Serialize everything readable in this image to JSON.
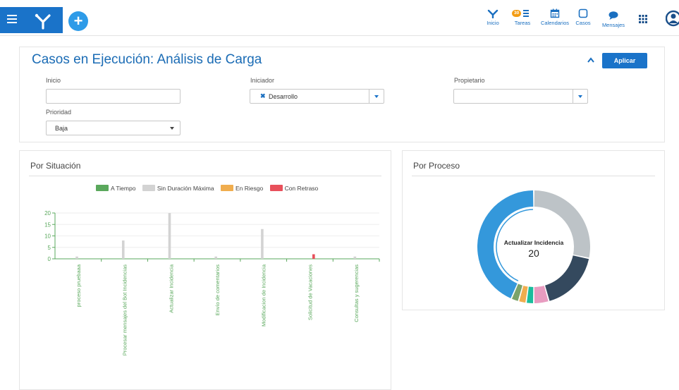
{
  "topbar": {
    "nav": [
      {
        "label": "Inicio",
        "icon": "home-branch-icon"
      },
      {
        "label": "Tareas",
        "icon": "tasks-icon",
        "badge": "30"
      },
      {
        "label": "Calendarios",
        "icon": "calendar-icon"
      },
      {
        "label": "Casos",
        "icon": "cases-icon"
      },
      {
        "label": "Mensajes",
        "icon": "messages-icon"
      }
    ],
    "add_label": "+"
  },
  "filter": {
    "title": "Casos en Ejecución: Análisis de Carga",
    "apply_label": "Aplicar",
    "inicio": {
      "label": "Inicio",
      "value": ""
    },
    "iniciador": {
      "label": "Iniciador",
      "tag": "Desarrollo",
      "remove": "✖"
    },
    "propietario": {
      "label": "Propietario",
      "value": ""
    },
    "prioridad": {
      "label": "Prioridad",
      "value": "Baja"
    }
  },
  "situacion": {
    "title": "Por Situación",
    "legend": [
      {
        "label": "A Tiempo",
        "color": "#5aa85c"
      },
      {
        "label": "Sin Duración Máxima",
        "color": "#d3d3d3"
      },
      {
        "label": "En Riesgo",
        "color": "#f0ad4e"
      },
      {
        "label": "Con Retraso",
        "color": "#e8505b"
      }
    ]
  },
  "proceso": {
    "title": "Por Proceso",
    "center_label": "Actualizar Incidencia",
    "center_value": "20"
  },
  "chart_data": [
    {
      "type": "bar",
      "title": "Por Situación",
      "categories": [
        "proceso pruebaaa",
        "Procesar mensajes del Bot Incidencias",
        "Actualizar Incidencia",
        "Envío de comentarios",
        "Modificacion de Incidencia",
        "Solicitud de Vacaciones",
        "Consultas y sugerencias"
      ],
      "series": [
        {
          "name": "A Tiempo",
          "color": "#5aa85c",
          "values": [
            0,
            0,
            0,
            0,
            0,
            0,
            0
          ]
        },
        {
          "name": "Sin Duración Máxima",
          "color": "#d3d3d3",
          "values": [
            1,
            8,
            20,
            1,
            13,
            0,
            1
          ]
        },
        {
          "name": "En Riesgo",
          "color": "#f0ad4e",
          "values": [
            0,
            0,
            0,
            0,
            0,
            0,
            0
          ]
        },
        {
          "name": "Con Retraso",
          "color": "#e8505b",
          "values": [
            0,
            0,
            0,
            0,
            0,
            2,
            0
          ]
        }
      ],
      "ylim": [
        0,
        20
      ],
      "yticks": [
        0,
        5,
        10,
        15,
        20
      ],
      "grid": true,
      "legend": "top"
    },
    {
      "type": "pie",
      "title": "Por Proceso",
      "slices": [
        {
          "label": "Actualizar Incidencia",
          "value": 20,
          "color": "#3498db"
        },
        {
          "label": "Modificacion de Incidencia",
          "value": 13,
          "color": "#bdc3c7"
        },
        {
          "label": "Procesar mensajes del Bot Incidencias",
          "value": 8,
          "color": "#34495e"
        },
        {
          "label": "Solicitud de Vacaciones",
          "value": 2,
          "color": "#e89cc0"
        },
        {
          "label": "proceso pruebaaa",
          "value": 1,
          "color": "#1abc9c"
        },
        {
          "label": "Envío de comentarios",
          "value": 1,
          "color": "#f0ad4e"
        },
        {
          "label": "Consultas y sugerencias",
          "value": 1,
          "color": "#7aa36a"
        }
      ]
    }
  ]
}
